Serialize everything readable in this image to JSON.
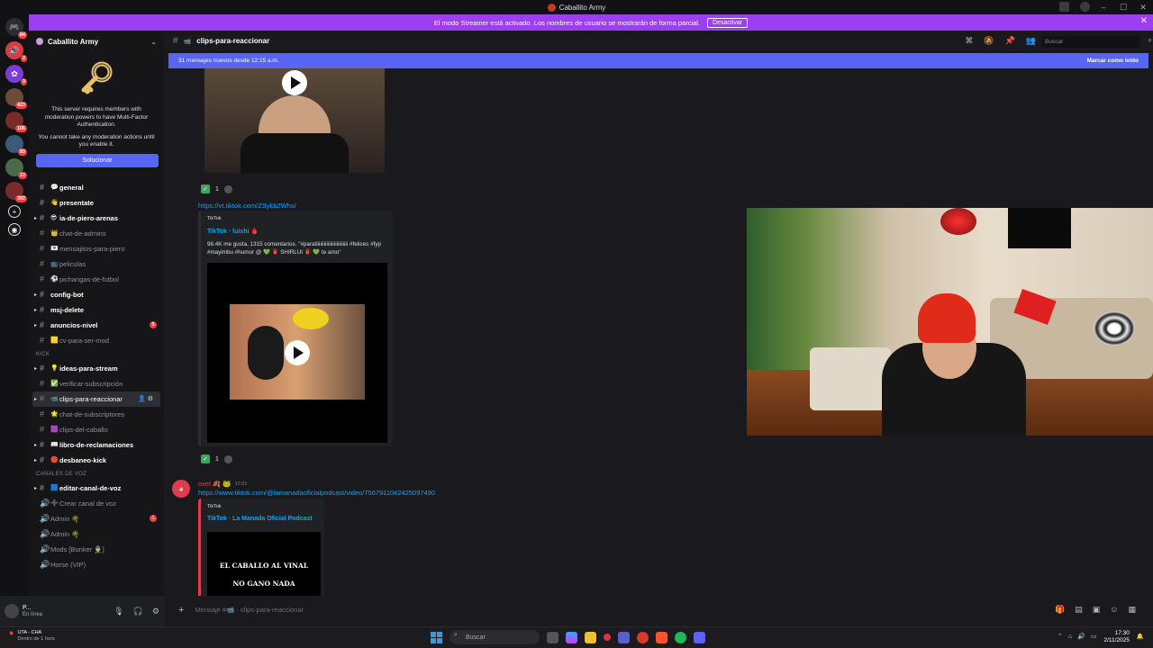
{
  "window": {
    "title": "Caballito Army"
  },
  "streamer_banner": {
    "text": "El modo Streamer está activado. Los nombres de usuario se mostrarán de forma parcial.",
    "button": "Desactivar"
  },
  "servers": [
    {
      "badge": "84"
    },
    {
      "badge": "2"
    },
    {
      "badge": "9"
    },
    {
      "badge": "423"
    },
    {
      "badge": "106"
    },
    {
      "badge": "93"
    },
    {
      "badge": "10"
    },
    {
      "badge": "392"
    }
  ],
  "sidebar": {
    "server_name": "Caballito Army",
    "mfa": {
      "line1": "This server requires members with moderation powers to have Multi-Factor Authentication.",
      "line2": "You cannot take any moderation actions until you enable it.",
      "button": "Solucionar"
    },
    "channels": [
      {
        "name": "general",
        "emoji": "💬",
        "bold": true
      },
      {
        "name": "presentate",
        "emoji": "👋",
        "bold": true
      },
      {
        "name": "ia-de-piero-arenas",
        "emoji": "😎",
        "bold": true,
        "arrow": true
      },
      {
        "name": "chat-de-admins",
        "emoji": "👑"
      },
      {
        "name": "mensajitos-para-piero",
        "emoji": "💌"
      },
      {
        "name": "peliculas",
        "emoji": "📺"
      },
      {
        "name": "pichangas-de-futbol",
        "emoji": "⚽"
      },
      {
        "name": "config-bot",
        "bold": true,
        "arrow": true,
        "plain": true
      },
      {
        "name": "msj-delete",
        "bold": true,
        "arrow": true,
        "plain": true
      },
      {
        "name": "anuncios-nivel",
        "bold": true,
        "arrow": true,
        "plain": true,
        "badge": "5"
      },
      {
        "name": "cv-para-ser-mod",
        "emoji": "🟨"
      }
    ],
    "category_kick": "KICK",
    "kick_channels": [
      {
        "name": "ideas-para-stream",
        "emoji": "💡",
        "bold": true,
        "arrow": true
      },
      {
        "name": "verificar-subscripción",
        "emoji": "✅"
      },
      {
        "name": "clips-para-reaccionar",
        "emoji": "📹",
        "active": true,
        "arrow": true
      },
      {
        "name": "chat-de-subscriptores",
        "emoji": "🌟"
      },
      {
        "name": "clips-del-caballo",
        "emoji": "🟪"
      },
      {
        "name": "libro-de-reclamaciones",
        "emoji": "📖",
        "bold": true,
        "arrow": true
      },
      {
        "name": "desbaneo-kick",
        "emoji": "🔴",
        "bold": true,
        "arrow": true
      }
    ],
    "category_voice": "CANALES DE VOZ",
    "voice_channels": [
      {
        "name": "editar-canal-de-voz",
        "emoji": "🟦",
        "bold": true,
        "arrow": true,
        "type": "text"
      },
      {
        "name": "Crear canal de voz",
        "emoji": "➕",
        "type": "voice"
      },
      {
        "name": "Admin 🌴",
        "type": "voice",
        "badge": "1"
      },
      {
        "name": "Admin 🌴",
        "type": "voice"
      },
      {
        "name": "Mods [Bunker 👮‍♂️]",
        "type": "voice"
      },
      {
        "name": "Horse (VIP)",
        "type": "voice"
      }
    ]
  },
  "user": {
    "name": "P...",
    "status": "En línea"
  },
  "channel": {
    "name": "clips-para-reaccionar",
    "emoji": "📹",
    "search_placeholder": "Buscar"
  },
  "new_messages": {
    "text": "31 mensajes nuevos desde 12:15 a.m.",
    "mark": "Marcar como leído"
  },
  "messages": {
    "reaction_count": "1",
    "link1": "https://vt.tiktok.com/ZSykb2Whs/",
    "embed1": {
      "source": "TikTok",
      "title": "TikTok · luishi 🩸",
      "desc": "98.4K me gusta, 1315 comentarios. \"#paratiiiiiiiiiiiiiiiiiiiiiiiii #felices #fyp #mayimbu #humor @ 💚 🧣 SHIRLUI 🧣 💚 te amo\""
    },
    "author2": {
      "name": "oxel 🍂 🐸",
      "time": "17:01"
    },
    "link2": "https://www.tiktok.com/@lamanadaoficialpodcast/video/7567911042425097490",
    "embed2": {
      "source": "TikTok",
      "title": "TikTok · La Manada Oficial Podcast",
      "caption1": "EL CABALLO AL VINAL",
      "caption2": "NO GANO NADA"
    }
  },
  "input": {
    "placeholder": "Mensaje #📹 · clips-para-reaccionar"
  },
  "taskbar": {
    "weather": "UTA - CHA",
    "weather_sub": "Dentro de 1 hora",
    "search": "Buscar",
    "time": "17:30",
    "date": "2/11/2025"
  }
}
